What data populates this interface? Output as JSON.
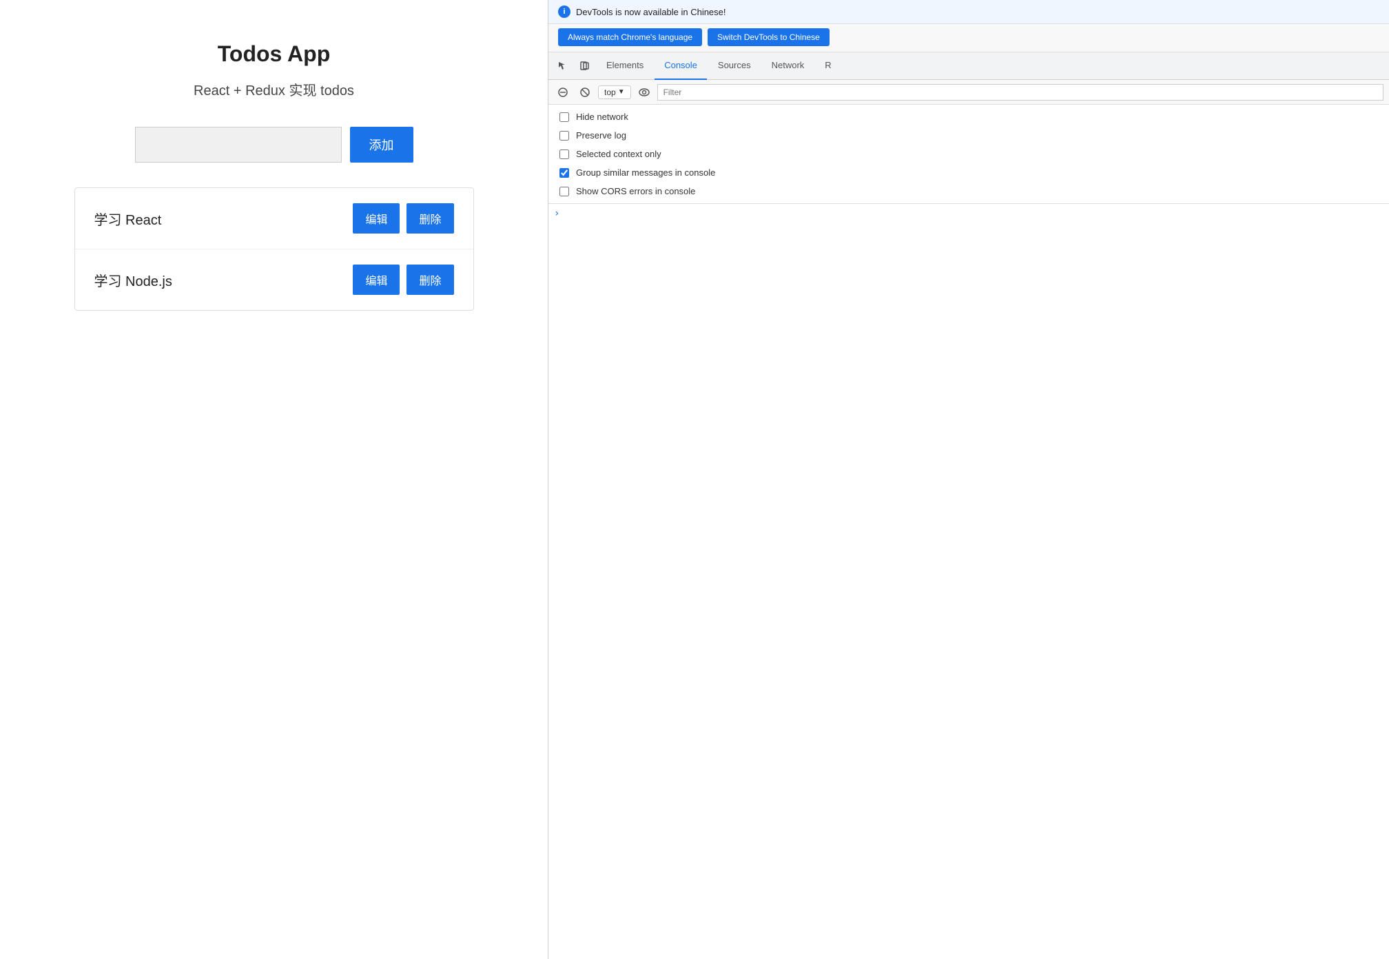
{
  "app": {
    "title": "Todos App",
    "subtitle": "React + Redux 实现 todos",
    "input_placeholder": "",
    "add_button_label": "添加",
    "todos": [
      {
        "id": 1,
        "text": "学习 React",
        "edit_label": "编辑",
        "delete_label": "删除"
      },
      {
        "id": 2,
        "text": "学习 Node.js",
        "edit_label": "编辑",
        "delete_label": "删除"
      }
    ]
  },
  "devtools": {
    "notification": {
      "info_icon": "i",
      "message": "DevTools is now available in Chinese!"
    },
    "lang_buttons": [
      {
        "label": "Always match Chrome's language"
      },
      {
        "label": "Switch DevTools to Chinese"
      }
    ],
    "tabs": [
      {
        "label": "Elements",
        "active": false
      },
      {
        "label": "Console",
        "active": true
      },
      {
        "label": "Sources",
        "active": false
      },
      {
        "label": "Network",
        "active": false
      },
      {
        "label": "R",
        "active": false
      }
    ],
    "toolbar": {
      "context_label": "top",
      "filter_placeholder": "Filter"
    },
    "settings": [
      {
        "label": "Hide network",
        "checked": false
      },
      {
        "label": "Preserve log",
        "checked": false
      },
      {
        "label": "Selected context only",
        "checked": false
      },
      {
        "label": "Group similar messages in console",
        "checked": true
      },
      {
        "label": "Show CORS errors in console",
        "checked": false
      }
    ]
  }
}
